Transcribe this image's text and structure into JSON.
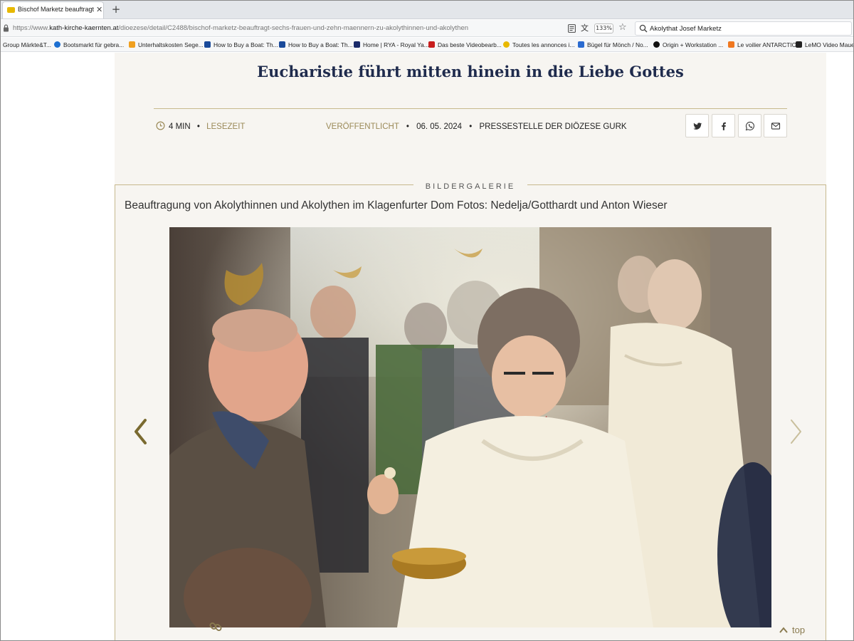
{
  "browser": {
    "tab_title": "Bischof Marketz beauftragt sech",
    "tab_close": "✕",
    "new_tab": "+",
    "url_prefix": "https://www.",
    "url_domain": "kath-kirche-kaernten.at",
    "url_path": "/dioezese/detail/C2488/bischof-marketz-beauftragt-sechs-frauen-und-zehn-maennern-zu-akolythinnen-und-akolythen",
    "zoom": "133%",
    "search_text": "Akolythat  Josef Marketz"
  },
  "bookmarks": [
    {
      "label": "Group Märkte&T...",
      "color": ""
    },
    {
      "label": "Bootsmarkt für gebra...",
      "color": "#1d6fd1"
    },
    {
      "label": "Unterhaltskosten Sege...",
      "color": "#f0a020"
    },
    {
      "label": "How to Buy a Boat: Th...",
      "color": "#1a4a9a"
    },
    {
      "label": "How to Buy a Boat: Th...",
      "color": "#1a4a9a"
    },
    {
      "label": "Home | RYA - Royal Ya...",
      "color": "#1a2a6a"
    },
    {
      "label": "Das beste Videobearb...",
      "color": "#c81e1e"
    },
    {
      "label": "Toutes les annonces i...",
      "color": "#e8b800"
    },
    {
      "label": "Bügel für Mönch / No...",
      "color": "#2a6bd0"
    },
    {
      "label": "Origin + Workstation ...",
      "color": "#111111"
    },
    {
      "label": "Le voilier ANTARCTIC",
      "color": "#f07820"
    },
    {
      "label": "LeMO Video Mauer...",
      "color": "#222222"
    }
  ],
  "article": {
    "title": "Eucharistie führt mitten hinein in die Liebe Gottes",
    "read_minutes": "4 MIN",
    "read_label": "LESEZEIT",
    "published_label": "VERÖFFENTLICHT",
    "published_date": "06. 05. 2024",
    "publisher": "PRESSESTELLE DER DIÖZESE GURK",
    "bullet": "•"
  },
  "share": {
    "twitter": "twitter-icon",
    "facebook": "facebook-icon",
    "whatsapp": "whatsapp-icon",
    "email": "mail-icon"
  },
  "gallery": {
    "label": "BILDERGALERIE",
    "caption": "Beauftragung von Akolythinnen und Akolythen im Klagenfurter Dom Fotos: Nedelja/Gotthardt und Anton Wieser"
  },
  "footer": {
    "top_label": "top"
  },
  "colors": {
    "title": "#1f2b4d",
    "gold": "#9b8a58",
    "panel": "#f7f5f1"
  }
}
